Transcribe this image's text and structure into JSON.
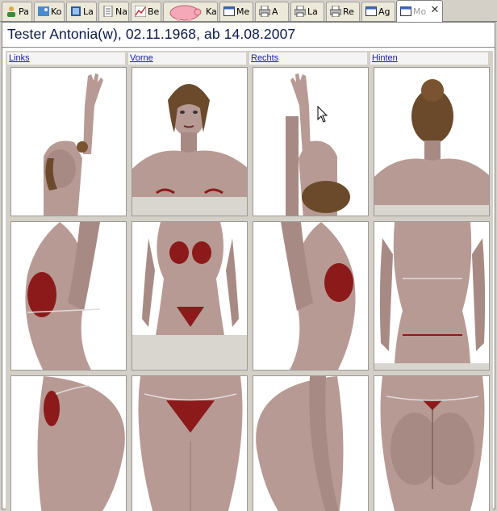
{
  "tabs": [
    {
      "label": "Pa",
      "icon": "person-icon"
    },
    {
      "label": "Ko",
      "icon": "image-icon"
    },
    {
      "label": "La",
      "icon": "lab-icon"
    },
    {
      "label": "Na",
      "icon": "document-icon"
    },
    {
      "label": "Be",
      "icon": "chart-icon"
    },
    {
      "label": "Ka",
      "icon": "piggy-bank-icon"
    },
    {
      "label": "Me",
      "icon": "window-icon"
    },
    {
      "label": "A",
      "icon": "printer-icon"
    },
    {
      "label": "La",
      "icon": "printer-icon"
    },
    {
      "label": "Re",
      "icon": "printer-icon"
    },
    {
      "label": "Ag",
      "icon": "window-icon"
    },
    {
      "label": "Mo",
      "icon": "window-icon"
    }
  ],
  "close_glyph": "✕",
  "patient_title": "Tester Antonia(w), 02.11.1968, ab 14.08.2007",
  "columns": [
    "Links",
    "Vorne",
    "Rechts",
    "Hinten"
  ],
  "colors": {
    "title": "#0a1a4a",
    "link": "#1a1aaa",
    "skin": "#b89a94",
    "bikini": "#8c1a1a"
  }
}
